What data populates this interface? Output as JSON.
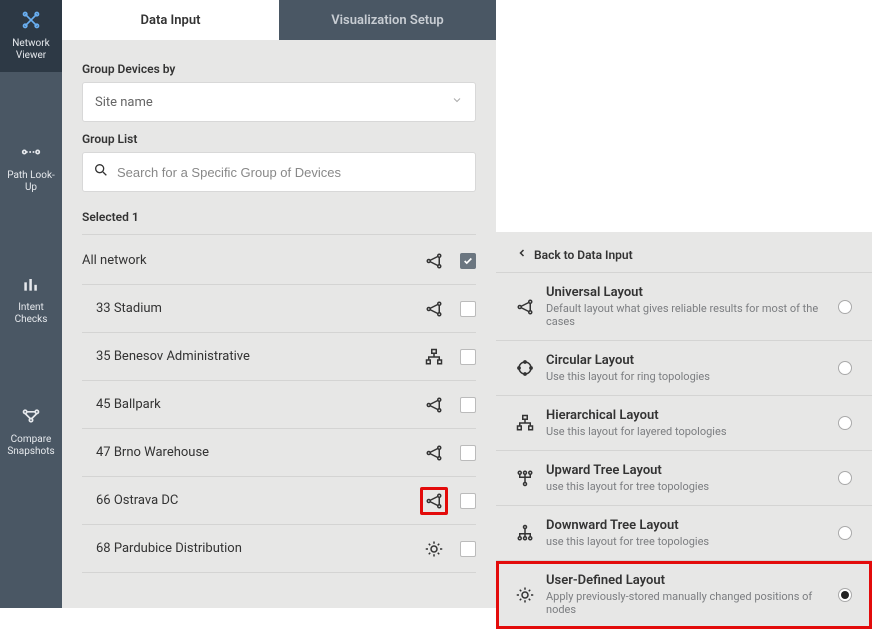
{
  "sidebar": {
    "items": [
      {
        "label": "Network Viewer"
      },
      {
        "label": "Path Look-Up"
      },
      {
        "label": "Intent Checks"
      },
      {
        "label": "Compare Snapshots"
      }
    ]
  },
  "left": {
    "tabs": {
      "active": "Data Input",
      "inactive": "Visualization Setup"
    },
    "group_by_label": "Group Devices by",
    "group_by_value": "Site name",
    "group_list_label": "Group List",
    "search_placeholder": "Search for a Specific Group of Devices",
    "selected_label": "Selected 1",
    "rows": [
      {
        "name": "All network",
        "checked": true,
        "indent": false,
        "icon": "net",
        "highlight": false
      },
      {
        "name": "33 Stadium",
        "checked": false,
        "indent": true,
        "icon": "net",
        "highlight": false
      },
      {
        "name": "35 Benesov Administrative",
        "checked": false,
        "indent": true,
        "icon": "tree",
        "highlight": false
      },
      {
        "name": "45 Ballpark",
        "checked": false,
        "indent": true,
        "icon": "net",
        "highlight": false
      },
      {
        "name": "47 Brno Warehouse",
        "checked": false,
        "indent": true,
        "icon": "net",
        "highlight": false
      },
      {
        "name": "66 Ostrava DC",
        "checked": false,
        "indent": true,
        "icon": "net",
        "highlight": true
      },
      {
        "name": "68 Pardubice Distribution",
        "checked": false,
        "indent": true,
        "icon": "user",
        "highlight": false
      }
    ]
  },
  "right": {
    "back": "Back to Data Input",
    "layouts": [
      {
        "key": "universal",
        "title": "Universal Layout",
        "desc": "Default layout what gives reliable results for most of the cases",
        "selected": false,
        "highlight": false
      },
      {
        "key": "circular",
        "title": "Circular Layout",
        "desc": "Use this layout for ring topologies",
        "selected": false,
        "highlight": false
      },
      {
        "key": "hierarchical",
        "title": "Hierarchical Layout",
        "desc": "Use this layout for layered topologies",
        "selected": false,
        "highlight": false
      },
      {
        "key": "up-tree",
        "title": "Upward Tree Layout",
        "desc": "use this layout for tree topologies",
        "selected": false,
        "highlight": false
      },
      {
        "key": "down-tree",
        "title": "Downward Tree Layout",
        "desc": "use this layout for tree topologies",
        "selected": false,
        "highlight": false
      },
      {
        "key": "user",
        "title": "User-Defined Layout",
        "desc": "Apply previously-stored manually changed positions of nodes",
        "selected": true,
        "highlight": true
      }
    ]
  }
}
